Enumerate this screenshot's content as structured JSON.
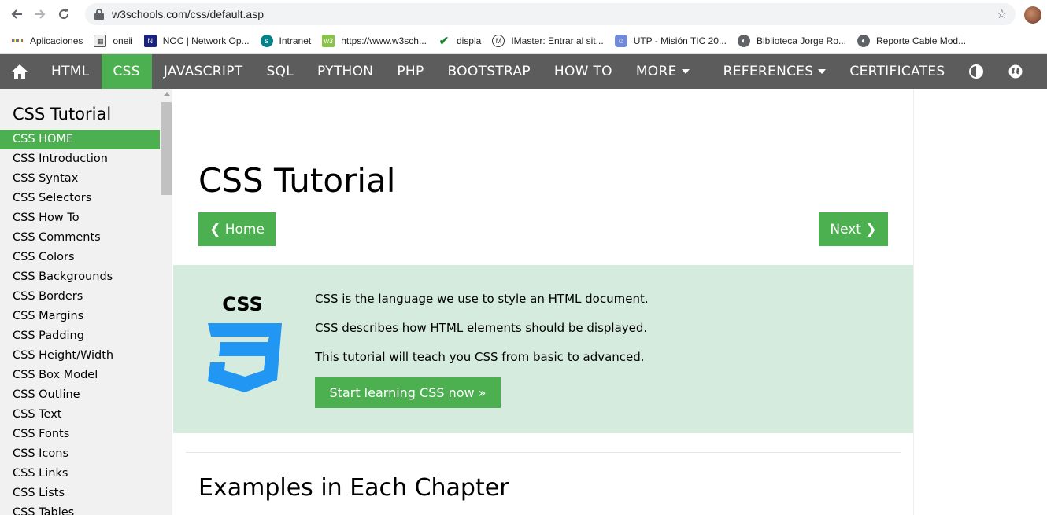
{
  "browser": {
    "url": "w3schools.com/css/default.asp",
    "bookmarks": [
      {
        "label": "Aplicaciones",
        "icon": "apps-icon"
      },
      {
        "label": "oneii",
        "icon": "oneii-icon"
      },
      {
        "label": "NOC | Network Op...",
        "icon": "noc-icon"
      },
      {
        "label": "Intranet",
        "icon": "sharepoint-icon"
      },
      {
        "label": "https://www.w3sch...",
        "icon": "w3schools-icon"
      },
      {
        "label": "displa",
        "icon": "checkmark-icon"
      },
      {
        "label": "IMaster: Entrar al sit...",
        "icon": "imaster-icon"
      },
      {
        "label": "UTP - Misión TIC 20...",
        "icon": "discord-icon"
      },
      {
        "label": "Biblioteca Jorge Ro...",
        "icon": "globe-icon"
      },
      {
        "label": "Reporte Cable Mod...",
        "icon": "globe-icon"
      }
    ]
  },
  "topnav": {
    "items": [
      {
        "label": "HTML"
      },
      {
        "label": "CSS"
      },
      {
        "label": "JAVASCRIPT"
      },
      {
        "label": "SQL"
      },
      {
        "label": "PYTHON"
      },
      {
        "label": "PHP"
      },
      {
        "label": "BOOTSTRAP"
      },
      {
        "label": "HOW TO"
      },
      {
        "label": "MORE"
      },
      {
        "label": "REFERENCES"
      },
      {
        "label": "CERTIFICATES"
      }
    ],
    "active_color": "#4caf50",
    "bar_color": "#5c5c5c"
  },
  "sidebar": {
    "title": "CSS Tutorial",
    "items": [
      {
        "label": "CSS HOME"
      },
      {
        "label": "CSS Introduction"
      },
      {
        "label": "CSS Syntax"
      },
      {
        "label": "CSS Selectors"
      },
      {
        "label": "CSS How To"
      },
      {
        "label": "CSS Comments"
      },
      {
        "label": "CSS Colors"
      },
      {
        "label": "CSS Backgrounds"
      },
      {
        "label": "CSS Borders"
      },
      {
        "label": "CSS Margins"
      },
      {
        "label": "CSS Padding"
      },
      {
        "label": "CSS Height/Width"
      },
      {
        "label": "CSS Box Model"
      },
      {
        "label": "CSS Outline"
      },
      {
        "label": "CSS Text"
      },
      {
        "label": "CSS Fonts"
      },
      {
        "label": "CSS Icons"
      },
      {
        "label": "CSS Links"
      },
      {
        "label": "CSS Lists"
      },
      {
        "label": "CSS Tables"
      }
    ]
  },
  "main": {
    "title": "CSS Tutorial",
    "home_button": "❮ Home",
    "next_button": "Next ❯",
    "hero": {
      "logo_text": "CSS",
      "lines": [
        "CSS is the language we use to style an HTML document.",
        "CSS describes how HTML elements should be displayed.",
        "This tutorial will teach you CSS from basic to advanced."
      ],
      "cta": "Start learning CSS now »",
      "background": "#d4ebdd"
    },
    "section_heading": "Examples in Each Chapter"
  }
}
